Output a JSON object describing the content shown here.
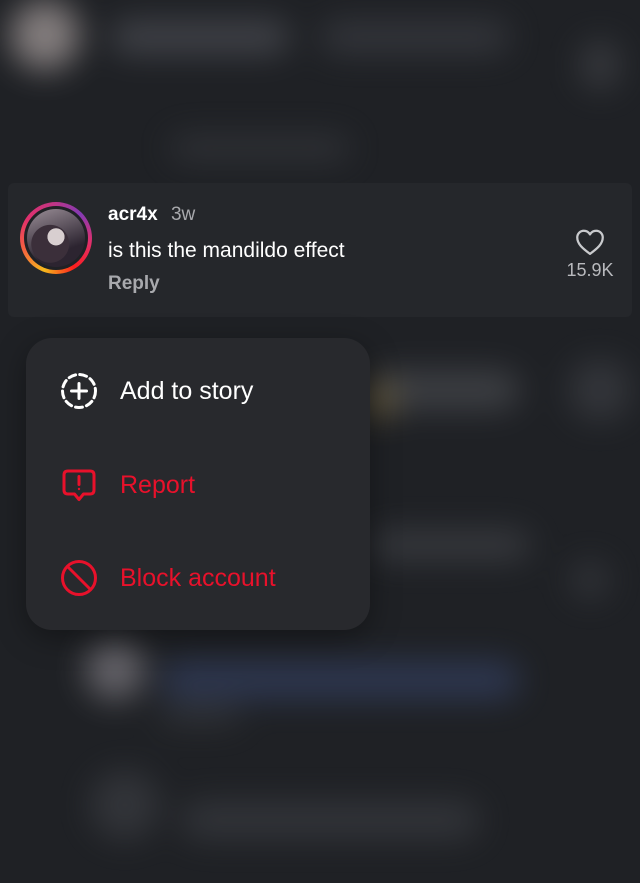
{
  "comment": {
    "username": "acr4x",
    "time_ago": "3w",
    "text": "is this the mandildo effect",
    "reply_label": "Reply",
    "like_count": "15.9K"
  },
  "menu": {
    "items": [
      {
        "label": "Add to story",
        "icon": "add-to-story-icon",
        "color": "#ffffff"
      },
      {
        "label": "Report",
        "icon": "report-icon",
        "color": "#e8112b"
      },
      {
        "label": "Block account",
        "icon": "block-icon",
        "color": "#e8112b"
      }
    ]
  },
  "colors": {
    "background": "#1f2125",
    "card": "#25272b",
    "menu": "#28292d",
    "danger": "#e8112b",
    "secondary_text": "#a8a9ad"
  }
}
